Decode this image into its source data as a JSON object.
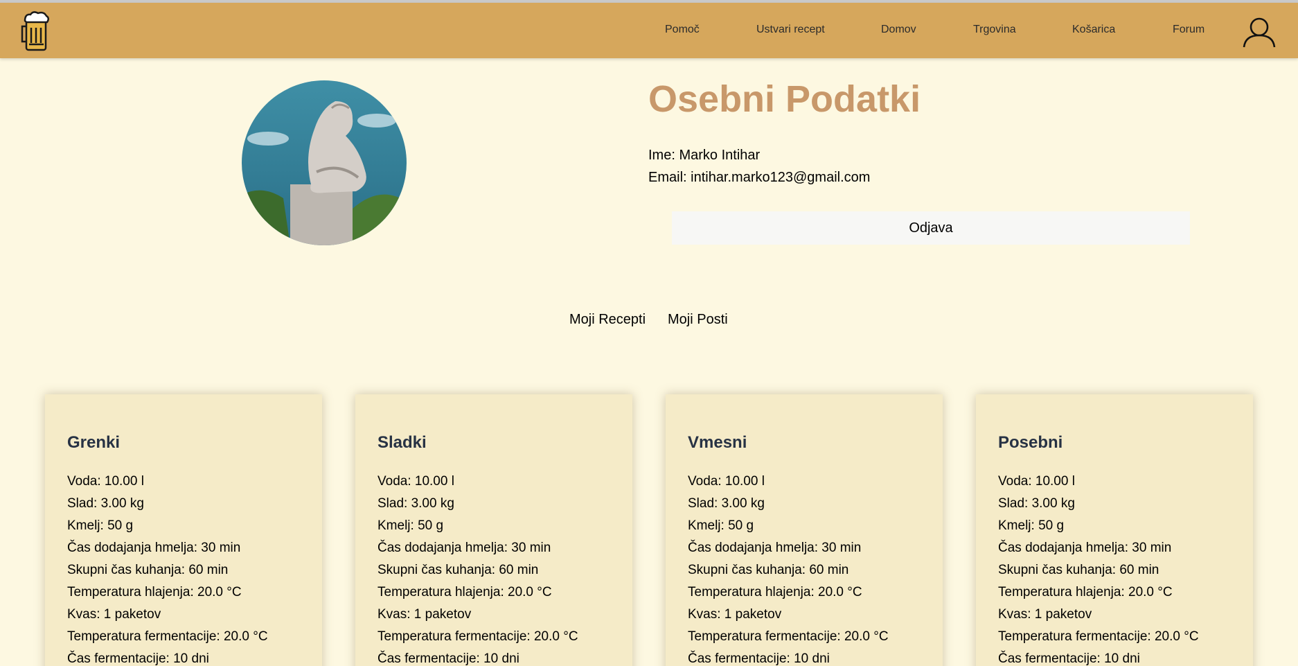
{
  "nav": {
    "items": [
      "Pomoč",
      "Ustvari recept",
      "Domov",
      "Trgovina",
      "Košarica",
      "Forum"
    ]
  },
  "profile": {
    "title": "Osebni Podatki",
    "name_line": "Ime: Marko Intihar",
    "email_line": "Email: intihar.marko123@gmail.com",
    "logout_label": "Odjava"
  },
  "tabs": [
    "Moji Recepti",
    "Moji Posti"
  ],
  "recipes": [
    {
      "title": "Grenki",
      "lines": [
        "Voda: 10.00 l",
        "Slad: 3.00 kg",
        "Kmelj: 50 g",
        "Čas dodajanja hmelja: 30 min",
        "Skupni čas kuhanja: 60 min",
        "Temperatura hlajenja: 20.0 °C",
        "Kvas: 1 paketov",
        "Temperatura fermentacije: 20.0 °C",
        "Čas fermentacije: 10 dni"
      ]
    },
    {
      "title": "Sladki",
      "lines": [
        "Voda: 10.00 l",
        "Slad: 3.00 kg",
        "Kmelj: 50 g",
        "Čas dodajanja hmelja: 30 min",
        "Skupni čas kuhanja: 60 min",
        "Temperatura hlajenja: 20.0 °C",
        "Kvas: 1 paketov",
        "Temperatura fermentacije: 20.0 °C",
        "Čas fermentacije: 10 dni"
      ]
    },
    {
      "title": "Vmesni",
      "lines": [
        "Voda: 10.00 l",
        "Slad: 3.00 kg",
        "Kmelj: 50 g",
        "Čas dodajanja hmelja: 30 min",
        "Skupni čas kuhanja: 60 min",
        "Temperatura hlajenja: 20.0 °C",
        "Kvas: 1 paketov",
        "Temperatura fermentacije: 20.0 °C",
        "Čas fermentacije: 10 dni"
      ]
    },
    {
      "title": "Posebni",
      "lines": [
        "Voda: 10.00 l",
        "Slad: 3.00 kg",
        "Kmelj: 50 g",
        "Čas dodajanja hmelja: 30 min",
        "Skupni čas kuhanja: 60 min",
        "Temperatura hlajenja: 20.0 °C",
        "Kvas: 1 paketov",
        "Temperatura fermentacije: 20.0 °C",
        "Čas fermentacije: 10 dni"
      ]
    }
  ],
  "colors": {
    "navbar": "#d6a75c",
    "background": "#fdf8e1",
    "title_accent": "#c8986a",
    "card": "#f5ebc8",
    "card_title": "#273244"
  },
  "icons": [
    "beer-mug-icon",
    "user-icon"
  ]
}
